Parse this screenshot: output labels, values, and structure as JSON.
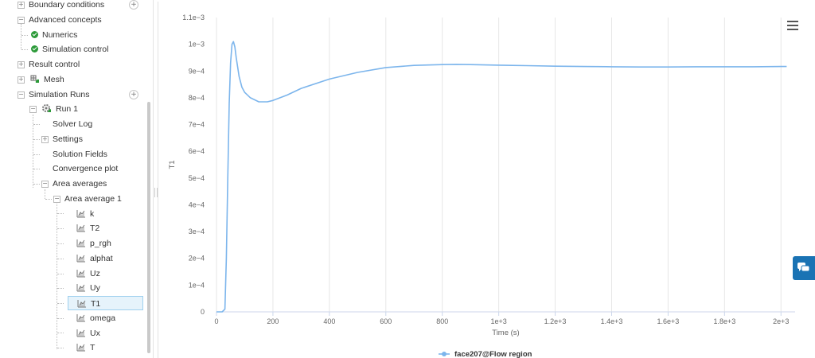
{
  "sidebar": {
    "items": [
      {
        "label": "Boundary conditions",
        "toggle": "+",
        "add": "+"
      },
      {
        "label": "Advanced concepts",
        "toggle": "−"
      },
      {
        "label": "Numerics",
        "icon": "check-icon"
      },
      {
        "label": "Simulation control",
        "icon": "check-icon"
      },
      {
        "label": "Result control",
        "toggle": "+"
      },
      {
        "label": "Mesh",
        "toggle": "+",
        "icon": "mesh-icon"
      },
      {
        "label": "Simulation Runs",
        "toggle": "−",
        "add": "+"
      },
      {
        "label": "Run 1",
        "toggle": "−",
        "icon": "run-gear-icon"
      },
      {
        "label": "Solver Log"
      },
      {
        "label": "Settings",
        "toggle": "+"
      },
      {
        "label": "Solution Fields"
      },
      {
        "label": "Convergence plot"
      },
      {
        "label": "Area averages",
        "toggle": "−"
      },
      {
        "label": "Area average 1",
        "toggle": "−"
      },
      {
        "label": "k",
        "icon": "line-chart-icon"
      },
      {
        "label": "T2",
        "icon": "line-chart-icon"
      },
      {
        "label": "p_rgh",
        "icon": "line-chart-icon"
      },
      {
        "label": "alphat",
        "icon": "line-chart-icon"
      },
      {
        "label": "Uz",
        "icon": "line-chart-icon"
      },
      {
        "label": "Uy",
        "icon": "line-chart-icon"
      },
      {
        "label": "T1",
        "icon": "line-chart-icon",
        "selected": true
      },
      {
        "label": "omega",
        "icon": "line-chart-icon"
      },
      {
        "label": "Ux",
        "icon": "line-chart-icon"
      },
      {
        "label": "T",
        "icon": "line-chart-icon"
      }
    ]
  },
  "chart_data": {
    "type": "line",
    "title": "",
    "xlabel": "Time (s)",
    "ylabel": "T1",
    "xlim": [
      0,
      2050
    ],
    "ylim": [
      0,
      0.0011
    ],
    "x_ticks": [
      {
        "v": 0,
        "label": "0"
      },
      {
        "v": 200,
        "label": "200"
      },
      {
        "v": 400,
        "label": "400"
      },
      {
        "v": 600,
        "label": "600"
      },
      {
        "v": 800,
        "label": "800"
      },
      {
        "v": 1000,
        "label": "1e+3"
      },
      {
        "v": 1200,
        "label": "1.2e+3"
      },
      {
        "v": 1400,
        "label": "1.4e+3"
      },
      {
        "v": 1600,
        "label": "1.6e+3"
      },
      {
        "v": 1800,
        "label": "1.8e+3"
      },
      {
        "v": 2000,
        "label": "2e+3"
      }
    ],
    "y_ticks": [
      {
        "v": 0,
        "label": "0"
      },
      {
        "v": 0.0001,
        "label": "1e−4"
      },
      {
        "v": 0.0002,
        "label": "2e−4"
      },
      {
        "v": 0.0003,
        "label": "3e−4"
      },
      {
        "v": 0.0004,
        "label": "4e−4"
      },
      {
        "v": 0.0005,
        "label": "5e−4"
      },
      {
        "v": 0.0006,
        "label": "6e−4"
      },
      {
        "v": 0.0007,
        "label": "7e−4"
      },
      {
        "v": 0.0008,
        "label": "8e−4"
      },
      {
        "v": 0.0009,
        "label": "9e−4"
      },
      {
        "v": 0.001,
        "label": "1e−3"
      },
      {
        "v": 0.0011,
        "label": "1.1e−3"
      }
    ],
    "grid": true,
    "legend": "bottom-center",
    "series": [
      {
        "name": "face207@Flow region",
        "color": "#7cb5ec",
        "x": [
          0,
          10,
          20,
          30,
          35,
          40,
          45,
          50,
          55,
          60,
          65,
          70,
          80,
          90,
          100,
          120,
          150,
          180,
          200,
          250,
          300,
          400,
          500,
          600,
          700,
          800,
          850,
          900,
          1000,
          1100,
          1200,
          1300,
          1400,
          1500,
          1600,
          1700,
          1800,
          1900,
          2000,
          2020
        ],
        "y": [
          0,
          0,
          0,
          1e-05,
          0.0002,
          0.0005,
          0.00078,
          0.00093,
          0.001,
          0.00101,
          0.00099,
          0.00095,
          0.00088,
          0.00084,
          0.00082,
          0.0008,
          0.000785,
          0.000785,
          0.00079,
          0.00081,
          0.000835,
          0.00087,
          0.000895,
          0.000913,
          0.000921,
          0.000924,
          0.000925,
          0.000924,
          0.000922,
          0.00092,
          0.000918,
          0.000917,
          0.000916,
          0.000915,
          0.000915,
          0.000916,
          0.000916,
          0.000916,
          0.000917,
          0.000917
        ]
      }
    ]
  },
  "colors": {
    "series": "#7cb5ec",
    "check": "#2c9a39",
    "chat_button": "#1a73b4",
    "selected_bg": "#e6f3fb"
  }
}
